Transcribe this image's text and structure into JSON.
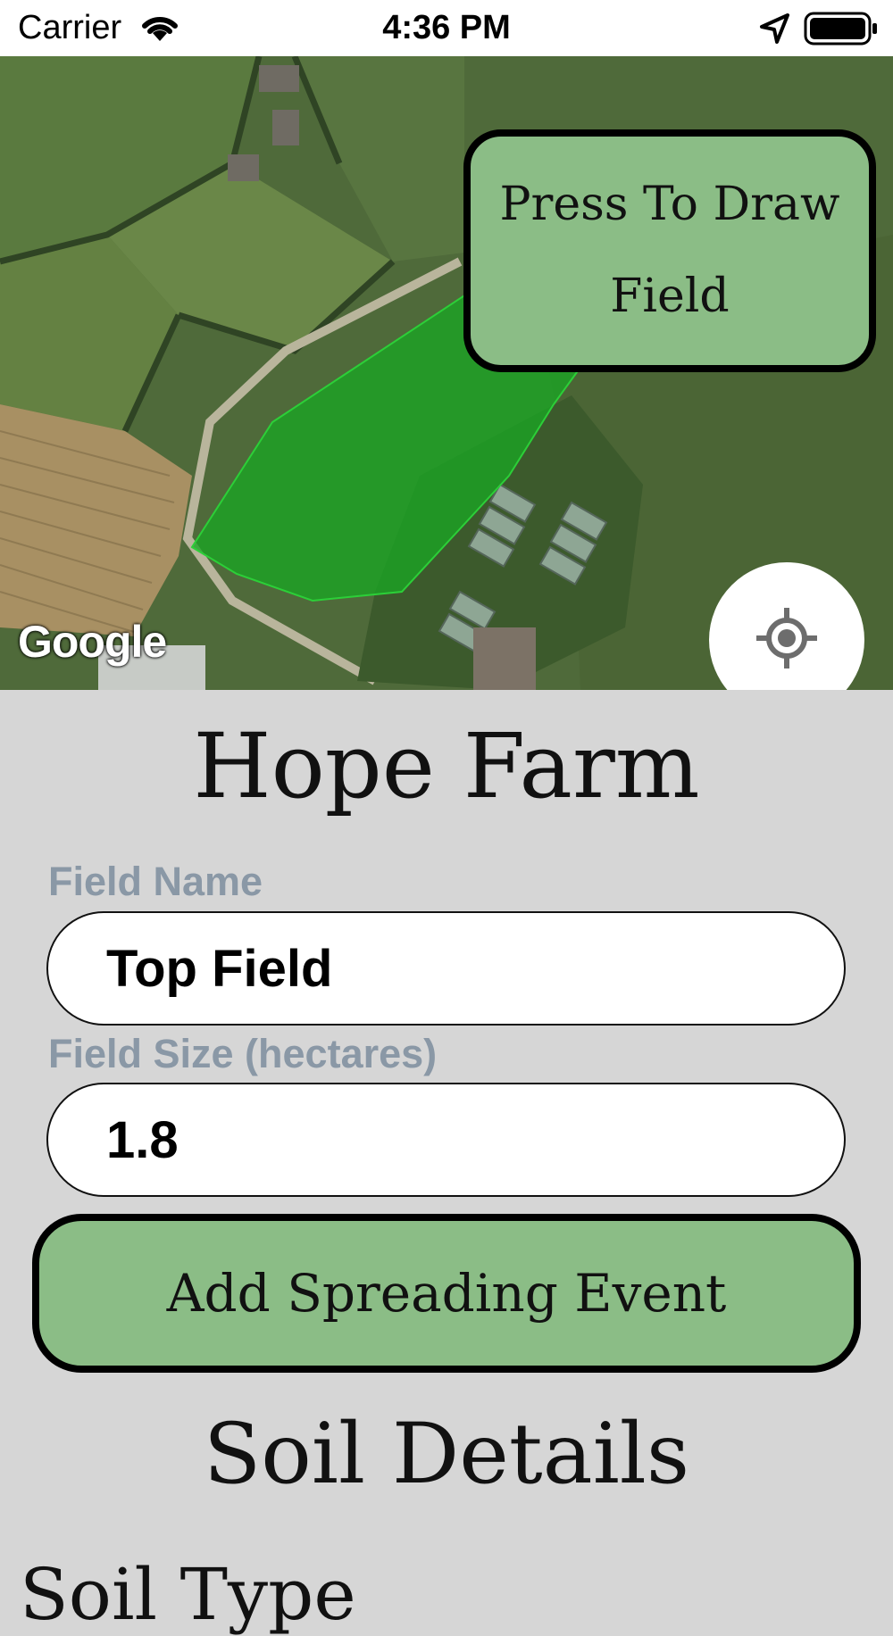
{
  "status_bar": {
    "carrier": "Carrier",
    "time": "4:36 PM",
    "icons": [
      "wifi-icon",
      "location-arrow-icon",
      "battery-icon"
    ]
  },
  "map": {
    "draw_button_label": "Press To Draw Field",
    "locate_icon": "crosshair-icon",
    "provider_logo": "Google",
    "field_polygon_color": "#1aa524"
  },
  "farm": {
    "title": "Hope Farm"
  },
  "form": {
    "field_name_label": "Field Name",
    "field_name_value": "Top Field",
    "field_size_label": "Field Size (hectares)",
    "field_size_value": "1.8",
    "add_event_button": "Add Spreading Event"
  },
  "soil": {
    "section_title": "Soil Details",
    "soil_type_label": "Soil Type"
  },
  "colors": {
    "accent_green": "#8bbd86",
    "background": "#d6d6d6",
    "label_gray": "#8a98a6"
  }
}
